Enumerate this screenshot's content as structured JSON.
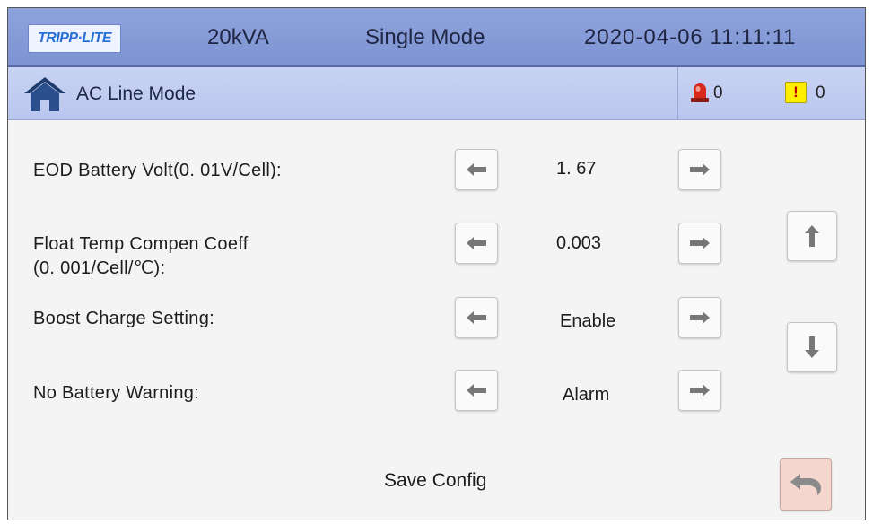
{
  "header": {
    "logo_text": "TRIPP·LITE",
    "capacity": "20kVA",
    "mode": "Single Mode",
    "datetime": "2020-04-06 11:11:11"
  },
  "subheader": {
    "title": "AC Line Mode",
    "alarm_count": "0",
    "warning_icon_text": "!",
    "warning_count": "0"
  },
  "settings": [
    {
      "label_line1": "EOD Battery Volt(0. 01V/Cell):",
      "label_line2": "",
      "value": "1. 67"
    },
    {
      "label_line1": "Float Temp Compen Coeff",
      "label_line2": "(0. 001/Cell/℃):",
      "value": "0.003"
    },
    {
      "label_line1": "Boost Charge Setting:",
      "label_line2": "",
      "value": "Enable"
    },
    {
      "label_line1": "No Battery Warning:",
      "label_line2": "",
      "value": "Alarm"
    }
  ],
  "footer": {
    "save_label": "Save Config"
  },
  "icons": {
    "decrease": "left-arrow-icon",
    "increase": "right-arrow-icon",
    "page_up": "up-arrow-icon",
    "page_down": "down-arrow-icon",
    "back": "return-icon",
    "home": "home-icon",
    "alarm": "alarm-light-icon"
  },
  "colors": {
    "topbar": "#7d93d3",
    "subbar": "#c0ccf0",
    "background": "#f4f4f4",
    "back_button": "#f6d7cf",
    "warning": "#ffee00",
    "alarm": "#d8281c"
  }
}
